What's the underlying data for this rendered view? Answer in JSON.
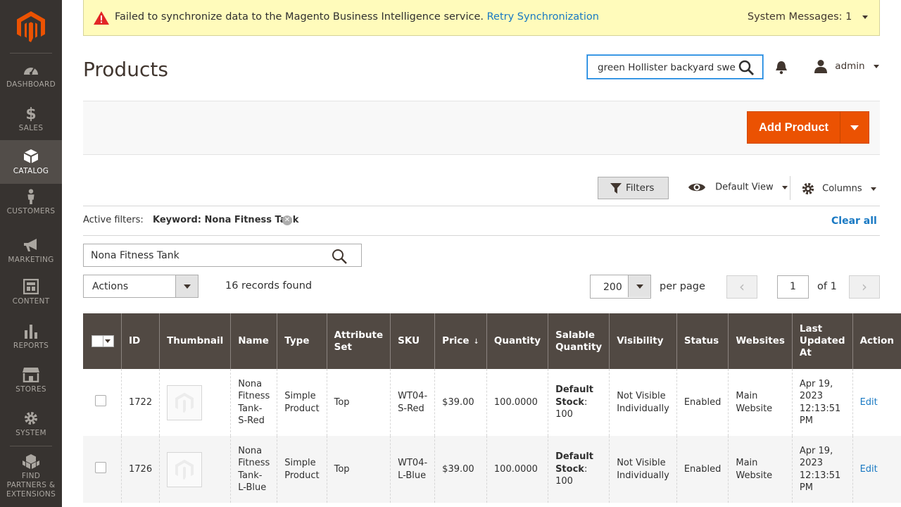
{
  "sidebar": {
    "items": [
      {
        "label": "DASHBOARD",
        "icon": "dashboard-icon"
      },
      {
        "label": "SALES",
        "icon": "dollar-icon"
      },
      {
        "label": "CATALOG",
        "icon": "cube-icon",
        "active": true
      },
      {
        "label": "CUSTOMERS",
        "icon": "person-icon"
      },
      {
        "label": "MARKETING",
        "icon": "megaphone-icon"
      },
      {
        "label": "CONTENT",
        "icon": "layout-icon"
      },
      {
        "label": "REPORTS",
        "icon": "bar-chart-icon"
      },
      {
        "label": "STORES",
        "icon": "store-icon"
      },
      {
        "label": "SYSTEM",
        "icon": "gear-icon"
      },
      {
        "label_lines": [
          "FIND",
          "PARTNERS &",
          "EXTENSIONS"
        ],
        "icon": "boxes-icon"
      }
    ]
  },
  "message": {
    "text": "Failed to synchronize data to the Magento Business Intelligence service.",
    "link": "Retry Synchronization",
    "system": "System Messages: 1"
  },
  "header": {
    "title": "Products",
    "search_value": "green Hollister backyard swe",
    "user": "admin"
  },
  "actions": {
    "add_product": "Add Product"
  },
  "toolbar": {
    "filters": "Filters",
    "view": "Default View",
    "columns": "Columns",
    "active_filters_label": "Active filters:",
    "keyword_filter": "Keyword: Nona Fitness Tank",
    "clear_all": "Clear all",
    "keyword_value": "Nona Fitness Tank",
    "mass_actions": "Actions",
    "records": "16 records found",
    "per_page_value": "200",
    "per_page_label": "per page",
    "page": "1",
    "of_pages": "of 1"
  },
  "grid": {
    "columns": [
      "ID",
      "Thumbnail",
      "Name",
      "Type",
      "Attribute Set",
      "SKU",
      "Price",
      "Quantity",
      "Salable Quantity",
      "Visibility",
      "Status",
      "Websites",
      "Last Updated At",
      "Action"
    ],
    "rows": [
      {
        "id": "1722",
        "name": "Nona Fitness Tank-S-Red",
        "type": "Simple Product",
        "attribute_set": "Top",
        "sku": "WT04-S-Red",
        "price": "$39.00",
        "quantity": "100.0000",
        "salable_label": "Default Stock",
        "salable_value": "100",
        "visibility": "Not Visible Individually",
        "status": "Enabled",
        "websites": "Main Website",
        "updated": "Apr 19, 2023 12:13:51 PM",
        "action": "Edit"
      },
      {
        "id": "1726",
        "name": "Nona Fitness Tank-L-Blue",
        "type": "Simple Product",
        "attribute_set": "Top",
        "sku": "WT04-L-Blue",
        "price": "$39.00",
        "quantity": "100.0000",
        "salable_label": "Default Stock",
        "salable_value": "100",
        "visibility": "Not Visible Individually",
        "status": "Enabled",
        "websites": "Main Website",
        "updated": "Apr 19, 2023 12:13:51 PM",
        "action": "Edit"
      }
    ]
  },
  "colors": {
    "sidebar": "#373330",
    "accent": "#eb5202",
    "link": "#1979c3",
    "grid_header": "#514943"
  }
}
